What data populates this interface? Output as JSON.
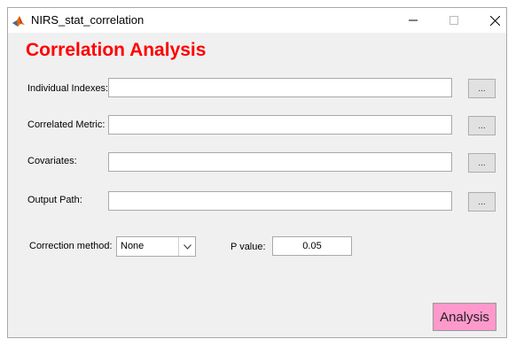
{
  "window": {
    "title": "NIRS_stat_correlation",
    "controls": {
      "minimize": "–",
      "maximize": "□",
      "close": "✕"
    },
    "app_icon": "matlab-logo-icon"
  },
  "heading": "Correlation Analysis",
  "fields": [
    {
      "label": "Individual Indexes:",
      "value": "",
      "browse_label": "..."
    },
    {
      "label": "Correlated Metric:",
      "value": "",
      "browse_label": "..."
    },
    {
      "label": "Covariates:",
      "value": "",
      "browse_label": "..."
    },
    {
      "label": "Output Path:",
      "value": "",
      "browse_label": "..."
    }
  ],
  "correction": {
    "label": "Correction method:",
    "selected": "None",
    "arrow_icon": "chevron-down-icon"
  },
  "pvalue": {
    "label": "P value:",
    "value": "0.05"
  },
  "analysis_button": {
    "label": "Analysis",
    "color": "#ff99cc"
  },
  "colors": {
    "heading": "#ff0000",
    "background": "#f0f0f0"
  }
}
